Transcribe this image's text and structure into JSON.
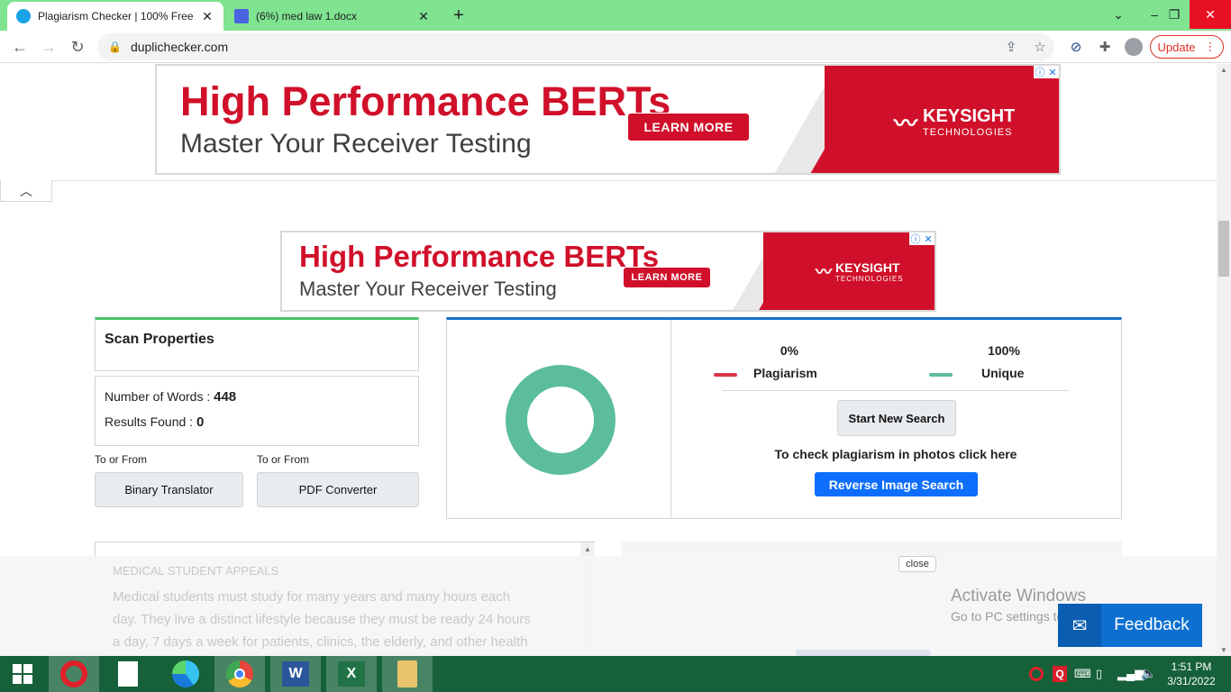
{
  "browser": {
    "tabs": [
      {
        "title": "Plagiarism Checker | 100% Free a",
        "active": true
      },
      {
        "title": "(6%) med law 1.docx",
        "active": false
      }
    ],
    "new_tab": "+",
    "url": "duplichecker.com",
    "update_label": "Update"
  },
  "ads": {
    "headline": "High Performance BERTs",
    "subline": "Master Your Receiver Testing",
    "cta": "LEARN MORE",
    "brand": "KEYSIGHT",
    "brand_sub": "TECHNOLOGIES"
  },
  "scan": {
    "title": "Scan Properties",
    "words_label": "Number of Words :",
    "words_value": "448",
    "results_label": "Results Found :",
    "results_value": "0",
    "to_from_1": "To or From",
    "to_from_2": "To or From",
    "binary_btn": "Binary Translator",
    "pdf_btn": "PDF Converter"
  },
  "result": {
    "plag_pct": "0%",
    "plag_label": "Plagiarism",
    "unique_pct": "100%",
    "unique_label": "Unique",
    "unique_fraction": 1.0,
    "start_new": "Start New Search",
    "photos_text": "To check plagiarism in photos click here",
    "reverse_btn": "Reverse Image Search",
    "colors": {
      "plagiarism": "#dc3545",
      "unique": "#5bbd9c"
    }
  },
  "text_panel": {
    "heading": "MEDICAL STUDENT APPEALS",
    "lines": [
      "Medical students must study for many years and many hours each",
      "day. They live a distinct lifestyle because they must be ready 24 hours",
      "a day, 7 days a week for patients, clinics, the elderly, and other health"
    ]
  },
  "overlay": {
    "close": "close",
    "activate_title": "Activate Windows",
    "activate_sub": "Go to PC settings to activate Windows.",
    "feedback": "Feedback"
  },
  "taskbar": {
    "time": "1:51 PM",
    "date": "3/31/2022",
    "tray_q": "Q"
  }
}
